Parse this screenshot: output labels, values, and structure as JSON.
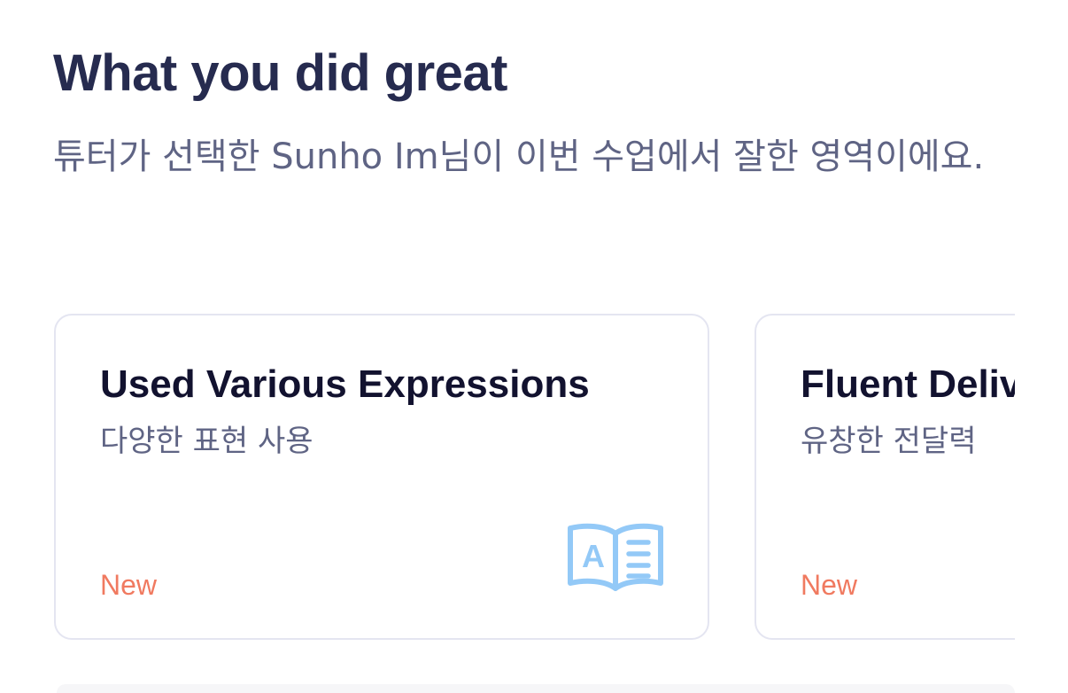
{
  "section": {
    "title": "What you did great",
    "description": "튜터가 선택한 Sunho Im님이 이번 수업에서 잘한 영역이에요."
  },
  "cards": [
    {
      "title": "Used Various Expressions",
      "subtitle": "다양한 표현 사용",
      "badge": "New",
      "icon": "open-book-letter-a-icon"
    },
    {
      "title": "Fluent Deliv",
      "subtitle": "유창한 전달력",
      "badge": "New"
    }
  ],
  "colors": {
    "title": "#262b4f",
    "description": "#5f6484",
    "card_border": "#e4e5f1",
    "badge": "#f07a60",
    "icon": "#93c9f7"
  }
}
